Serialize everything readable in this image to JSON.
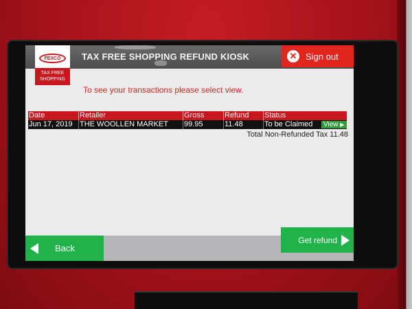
{
  "header": {
    "brand_oval": "FEXCO",
    "brand_band_line1": "TAX FREE",
    "brand_band_line2": "SHOPPING",
    "title": "TAX FREE SHOPPING REFUND KIOSK",
    "signout_label": "Sign out"
  },
  "instruction": "To see your transactions please select view.",
  "table": {
    "columns": [
      "Date",
      "Retailer",
      "Gross",
      "Refund",
      "Status"
    ],
    "rows": [
      {
        "date": "Jun 17, 2019",
        "retailer": "THE WOOLLEN MARKET",
        "gross": "99.95",
        "refund": "11.48",
        "status": "To be Claimed",
        "action_label": "View"
      }
    ]
  },
  "total_label": "Total Non-Refunded Tax 11.48",
  "footer": {
    "back_label": "Back",
    "refund_label": "Get refund"
  },
  "colors": {
    "kiosk_red": "#c8161e",
    "signout_red": "#e2261e",
    "action_green": "#1fb34a",
    "header_gray": "#5a5a5a"
  }
}
